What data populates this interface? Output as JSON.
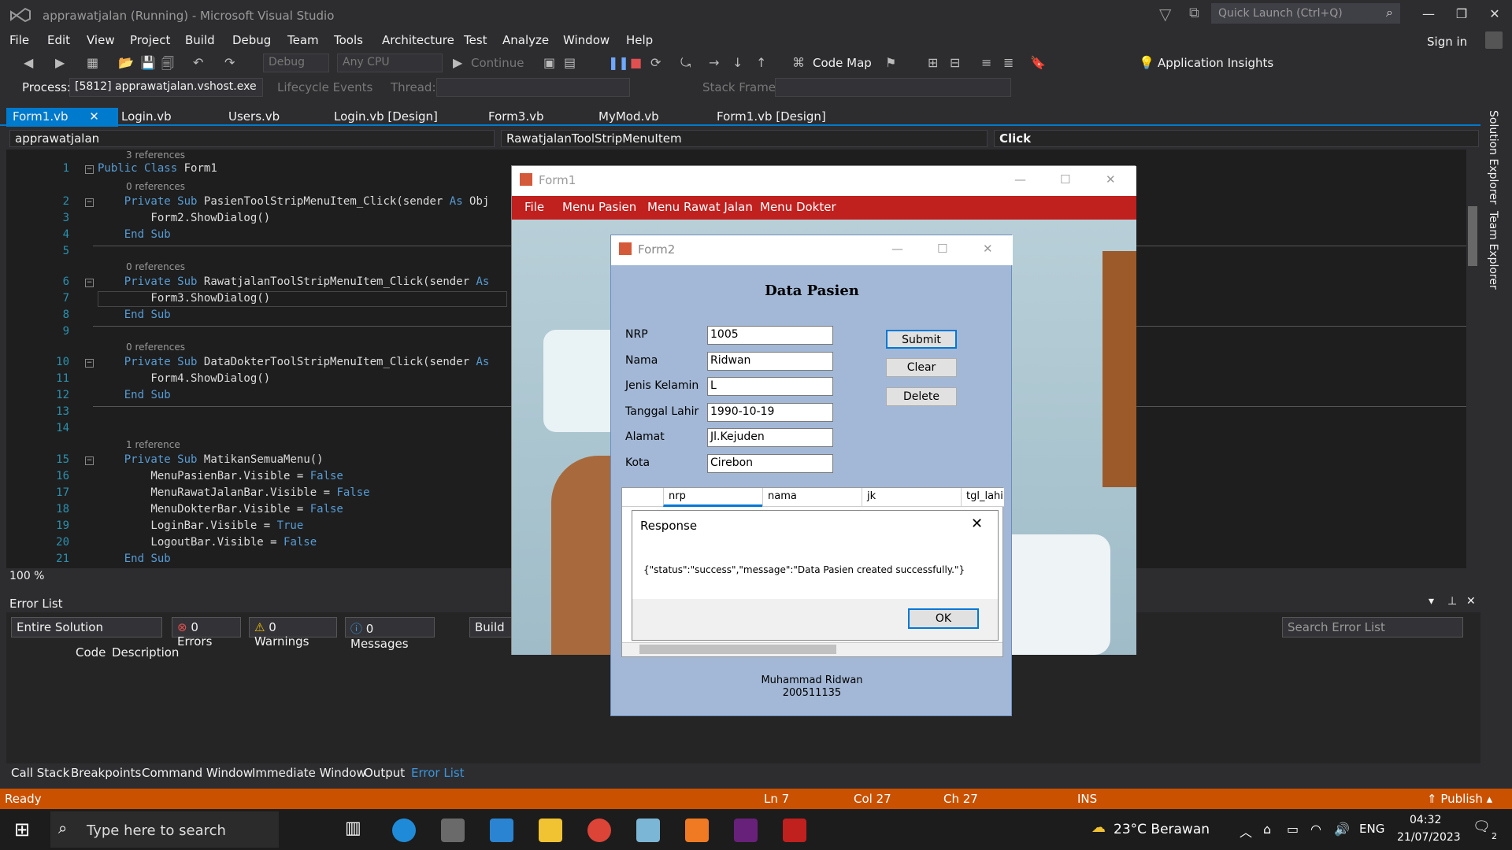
{
  "window": {
    "title": "apprawatjalan (Running) - Microsoft Visual Studio",
    "quick_launch_placeholder": "Quick Launch (Ctrl+Q)"
  },
  "menu": [
    "File",
    "Edit",
    "View",
    "Project",
    "Build",
    "Debug",
    "Team",
    "Tools",
    "Architecture",
    "Test",
    "Analyze",
    "Window",
    "Help"
  ],
  "signin": "Sign in",
  "toolbar": {
    "config": "Debug",
    "platform": "Any CPU",
    "continue": "Continue",
    "codemap": "Code Map",
    "insights": "Application Insights"
  },
  "debugbar": {
    "process_label": "Process:",
    "process": "[5812] apprawatjalan.vshost.exe",
    "lifecycle": "Lifecycle Events",
    "thread_label": "Thread:",
    "stackframe_label": "Stack Frame:"
  },
  "tabs": [
    "Form1.vb",
    "Login.vb",
    "Users.vb",
    "Login.vb [Design]",
    "Form3.vb",
    "MyMod.vb",
    "Form1.vb [Design]"
  ],
  "nav": {
    "project": "apprawatjalan",
    "member": "RawatjalanToolStripMenuItem",
    "event": "Click"
  },
  "side_tabs": [
    "Solution Explorer",
    "Team Explorer"
  ],
  "code": {
    "refs": [
      "3 references",
      "0 references",
      "0 references",
      "0 references",
      "1 reference"
    ],
    "lines": [
      {
        "n": "1",
        "t": "Public Class Form1"
      },
      {
        "n": "2",
        "t": "    Private Sub PasienToolStripMenuItem_Click(sender As Obj"
      },
      {
        "n": "3",
        "t": "        Form2.ShowDialog()"
      },
      {
        "n": "4",
        "t": "    End Sub"
      },
      {
        "n": "5",
        "t": ""
      },
      {
        "n": "6",
        "t": "    Private Sub RawatjalanToolStripMenuItem_Click(sender As"
      },
      {
        "n": "7",
        "t": "        Form3.ShowDialog()"
      },
      {
        "n": "8",
        "t": "    End Sub"
      },
      {
        "n": "9",
        "t": ""
      },
      {
        "n": "10",
        "t": "    Private Sub DataDokterToolStripMenuItem_Click(sender As"
      },
      {
        "n": "11",
        "t": "        Form4.ShowDialog()"
      },
      {
        "n": "12",
        "t": "    End Sub"
      },
      {
        "n": "13",
        "t": ""
      },
      {
        "n": "14",
        "t": ""
      },
      {
        "n": "15",
        "t": "    Private Sub MatikanSemuaMenu()"
      },
      {
        "n": "16",
        "t": "        MenuPasienBar.Visible = False"
      },
      {
        "n": "17",
        "t": "        MenuRawatJalanBar.Visible = False"
      },
      {
        "n": "18",
        "t": "        MenuDokterBar.Visible = False"
      },
      {
        "n": "19",
        "t": "        LoginBar.Visible = True"
      },
      {
        "n": "20",
        "t": "        LogoutBar.Visible = False"
      },
      {
        "n": "21",
        "t": "    End Sub"
      }
    ]
  },
  "zoom": "100 %",
  "errorlist": {
    "title": "Error List",
    "scope": "Entire Solution",
    "errors": "0 Errors",
    "warnings": "0 Warnings",
    "messages": "0 Messages",
    "build": "Build",
    "search": "Search Error List",
    "col_code": "Code",
    "col_desc": "Description"
  },
  "bottom_tabs": [
    "Call Stack",
    "Breakpoints",
    "Command Window",
    "Immediate Window",
    "Output",
    "Error List"
  ],
  "status": {
    "ready": "Ready",
    "ln": "Ln 7",
    "col": "Col 27",
    "ch": "Ch 27",
    "ins": "INS",
    "publish": "Publish"
  },
  "taskbar": {
    "search": "Type here to search",
    "weather": "23°C  Berawan",
    "lang": "ENG",
    "time": "04:32",
    "date": "21/07/2023",
    "notif": "2"
  },
  "form1": {
    "title": "Form1",
    "menu": [
      "File",
      "Menu Pasien",
      "Menu Rawat Jalan",
      "Menu Dokter"
    ]
  },
  "form2": {
    "title": "Form2",
    "heading": "Data Pasien",
    "fields": [
      {
        "label": "NRP",
        "value": "1005"
      },
      {
        "label": "Nama",
        "value": "Ridwan"
      },
      {
        "label": "Jenis Kelamin",
        "value": "L"
      },
      {
        "label": "Tanggal Lahir",
        "value": "1990-10-19"
      },
      {
        "label": "Alamat",
        "value": "Jl.Kejuden"
      },
      {
        "label": "Kota",
        "value": "Cirebon"
      }
    ],
    "buttons": [
      "Submit",
      "Clear",
      "Delete"
    ],
    "grid_cols": [
      "nrp",
      "nama",
      "jk",
      "tgl_lahir"
    ],
    "footer_name": "Muhammad Ridwan",
    "footer_id": "200511135"
  },
  "dialog": {
    "title": "Response",
    "message": "{\"status\":\"success\",\"message\":\"Data Pasien created successfully.\"}",
    "ok": "OK"
  },
  "colors": {
    "vs_blue": "#007acc",
    "status_orange": "#ca5100",
    "form_menu_red": "#c0201e",
    "form_bg": "#a3b8d6"
  }
}
